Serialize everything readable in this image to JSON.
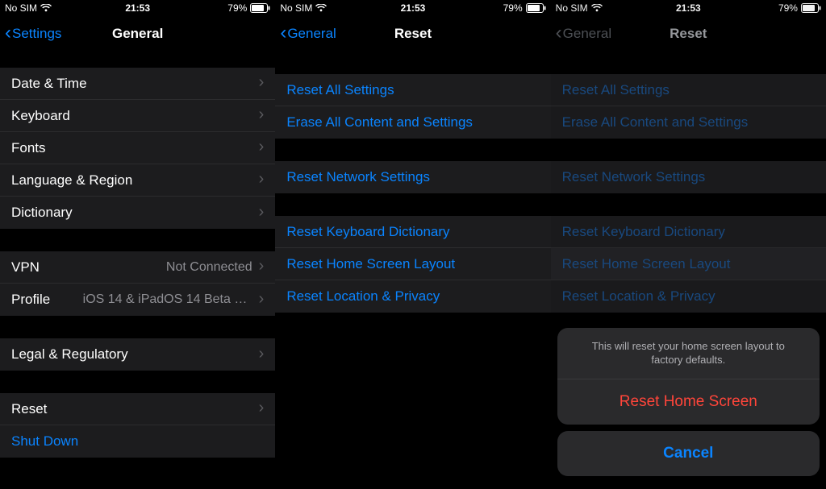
{
  "status": {
    "carrier": "No SIM",
    "time": "21:53",
    "battery_text": "79%"
  },
  "phone1": {
    "back": "Settings",
    "title": "General",
    "rows": {
      "date_time": "Date & Time",
      "keyboard": "Keyboard",
      "fonts": "Fonts",
      "lang_region": "Language & Region",
      "dictionary": "Dictionary",
      "vpn": "VPN",
      "vpn_val": "Not Connected",
      "profile": "Profile",
      "profile_val": "iOS 14 & iPadOS 14 Beta Softwar...",
      "legal": "Legal & Regulatory",
      "reset": "Reset",
      "shutdown": "Shut Down"
    }
  },
  "phone2": {
    "back": "General",
    "title": "Reset",
    "rows": {
      "reset_all": "Reset All Settings",
      "erase_all": "Erase All Content and Settings",
      "reset_network": "Reset Network Settings",
      "reset_kbd": "Reset Keyboard Dictionary",
      "reset_home": "Reset Home Screen Layout",
      "reset_loc": "Reset Location & Privacy"
    }
  },
  "phone3": {
    "back": "General",
    "title": "Reset",
    "rows": {
      "reset_all": "Reset All Settings",
      "erase_all": "Erase All Content and Settings",
      "reset_network": "Reset Network Settings",
      "reset_kbd": "Reset Keyboard Dictionary",
      "reset_home": "Reset Home Screen Layout",
      "reset_loc": "Reset Location & Privacy"
    },
    "sheet": {
      "message": "This will reset your home screen layout to factory defaults.",
      "destructive": "Reset Home Screen",
      "cancel": "Cancel"
    }
  }
}
